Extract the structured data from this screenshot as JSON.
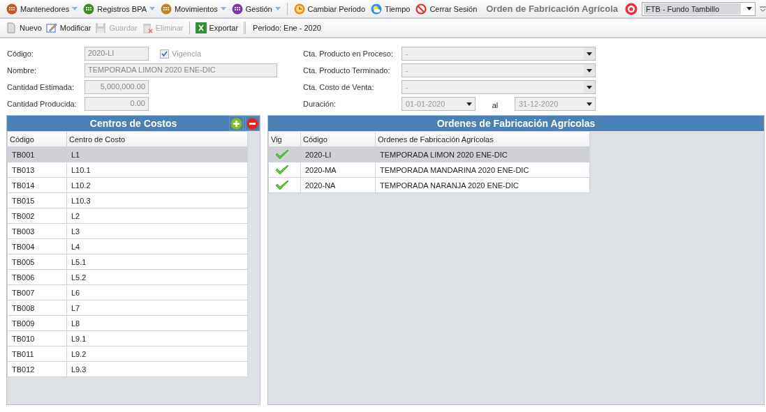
{
  "menubar": {
    "items": [
      {
        "kind": "menu",
        "label": "Mantenedores",
        "color": "#c8532c"
      },
      {
        "kind": "menu",
        "label": "Registros BPA",
        "color": "#3f8a2a"
      },
      {
        "kind": "menu",
        "label": "Movimientos",
        "color": "#b8862a"
      },
      {
        "kind": "menu",
        "label": "Gestión",
        "color": "#7b36a8"
      },
      {
        "kind": "action",
        "label": "Cambiar Periodo"
      },
      {
        "kind": "action",
        "label": "Tiempo"
      },
      {
        "kind": "action",
        "label": "Cerrar Sesión"
      }
    ],
    "title": "Orden de Fabricación Agrícola",
    "company": {
      "value": "FTB - Fundo Tambillo"
    }
  },
  "toolbar": {
    "items": [
      {
        "label": "Nuevo",
        "disabled": false
      },
      {
        "label": "Modificar",
        "disabled": false
      },
      {
        "label": "Guardar",
        "disabled": true
      },
      {
        "label": "Eliminar",
        "disabled": true
      },
      {
        "label": "Exportar",
        "disabled": false
      }
    ],
    "period": "Periodo: Ene - 2020"
  },
  "form": {
    "left": [
      {
        "label": "Código:",
        "value": "2020-LI",
        "kind": "code",
        "disabled": true,
        "checkbox": {
          "label": "Vigencia",
          "checked": true
        }
      },
      {
        "label": "Nombre:",
        "value": "TEMPORADA LIMON 2020 ENE-DIC",
        "kind": "wide",
        "disabled": true
      },
      {
        "label": "Cantidad Estimada:",
        "value": "5,000,000.00",
        "kind": "number",
        "disabled": true
      },
      {
        "label": "Cantidad Producida:",
        "value": "0.00",
        "kind": "number",
        "disabled": true
      }
    ],
    "right": [
      {
        "label": "Cta. Producto en Proceso:",
        "kind": "combo",
        "value": "-"
      },
      {
        "label": "Cta. Producto Terminado:",
        "kind": "combo",
        "value": "-"
      },
      {
        "label": "Cta. Costo de Venta:",
        "kind": "combo",
        "value": "-"
      },
      {
        "label": "Duración:",
        "kind": "range",
        "from": "01-01-2020",
        "separator": "al",
        "to": "31-12-2020"
      }
    ]
  },
  "cost_centers": {
    "title": "Centros de Costos",
    "columns": [
      "Código",
      "Centro de Costo"
    ],
    "rows": [
      {
        "code": "TB001",
        "name": "L1",
        "selected": true
      },
      {
        "code": "TB013",
        "name": "L10.1",
        "selected": false
      },
      {
        "code": "TB014",
        "name": "L10.2",
        "selected": false
      },
      {
        "code": "TB015",
        "name": "L10.3",
        "selected": false
      },
      {
        "code": "TB002",
        "name": "L2",
        "selected": false
      },
      {
        "code": "TB003",
        "name": "L3",
        "selected": false
      },
      {
        "code": "TB004",
        "name": "L4",
        "selected": false
      },
      {
        "code": "TB005",
        "name": "L5.1",
        "selected": false
      },
      {
        "code": "TB006",
        "name": "L5.2",
        "selected": false
      },
      {
        "code": "TB007",
        "name": "L6",
        "selected": false
      },
      {
        "code": "TB008",
        "name": "L7",
        "selected": false
      },
      {
        "code": "TB009",
        "name": "L8",
        "selected": false
      },
      {
        "code": "TB010",
        "name": "L9.1",
        "selected": false
      },
      {
        "code": "TB011",
        "name": "L9.2",
        "selected": false
      },
      {
        "code": "TB012",
        "name": "L9.3",
        "selected": false
      }
    ]
  },
  "orders": {
    "title": "Ordenes de Fabricación Agrícolas",
    "columns": [
      "Vig",
      "Código",
      "Ordenes de Fabricación Agrícolas"
    ],
    "rows": [
      {
        "vig": true,
        "code": "2020-LI",
        "name": "TEMPORADA LIMON 2020 ENE-DIC",
        "selected": true
      },
      {
        "vig": true,
        "code": "2020-MA",
        "name": "TEMPORADA MANDARINA 2020 ENE-DIC",
        "selected": false
      },
      {
        "vig": true,
        "code": "2020-NA",
        "name": "TEMPORADA NARANJA 2020 ENE-DIC",
        "selected": false
      }
    ]
  }
}
